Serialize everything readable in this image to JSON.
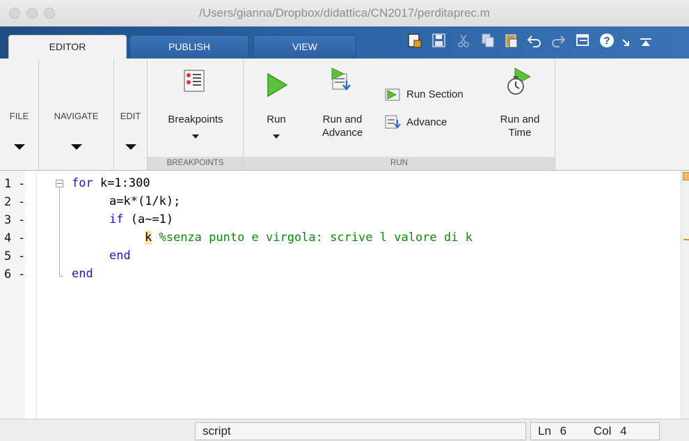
{
  "window": {
    "title": "/Users/gianna/Dropbox/didattica/CN2017/perditaprec.m"
  },
  "tabs": [
    {
      "label": "EDITOR",
      "active": true
    },
    {
      "label": "PUBLISH",
      "active": false
    },
    {
      "label": "VIEW",
      "active": false
    }
  ],
  "quick_access": [
    "new-script-icon",
    "save-icon",
    "cut-icon",
    "copy-icon",
    "paste-icon",
    "undo-icon",
    "redo-icon",
    "window-icon",
    "help-icon",
    "expand-icon"
  ],
  "ribbon": {
    "file": "FILE",
    "navigate": "NAVIGATE",
    "edit": "EDIT",
    "breakpoints_button": "Breakpoints",
    "breakpoints_group": "BREAKPOINTS",
    "run_button": "Run",
    "run_and_advance": [
      "Run and",
      "Advance"
    ],
    "run_section": "Run Section",
    "advance": "Advance",
    "run_and_time": [
      "Run and",
      "Time"
    ],
    "run_group": "RUN"
  },
  "editor": {
    "lines": [
      {
        "num": "1",
        "mark": "-",
        "keyword": "for",
        "text": " k=1:300",
        "comment": ""
      },
      {
        "num": "2",
        "mark": "-",
        "keyword": "",
        "text": "a=k*(1/k);",
        "comment": ""
      },
      {
        "num": "3",
        "mark": "-",
        "keyword": "if",
        "text": " (a~=1)",
        "comment": ""
      },
      {
        "num": "4",
        "mark": "-",
        "keyword": "",
        "text": "k",
        "comment": " %senza punto e virgola: scrive l valore di k"
      },
      {
        "num": "5",
        "mark": "-",
        "keyword": "end",
        "text": "",
        "comment": ""
      },
      {
        "num": "6",
        "mark": "-",
        "keyword": "end",
        "text": "",
        "comment": ""
      }
    ]
  },
  "status": {
    "file_type": "script",
    "ln_label": "Ln",
    "ln_value": "6",
    "col_label": "Col",
    "col_value": "4"
  },
  "colors": {
    "keyword": "#1515d6",
    "comment": "#0a8a0a",
    "tab_bar": "#2c63a3",
    "highlight": "#f6e4a8"
  }
}
